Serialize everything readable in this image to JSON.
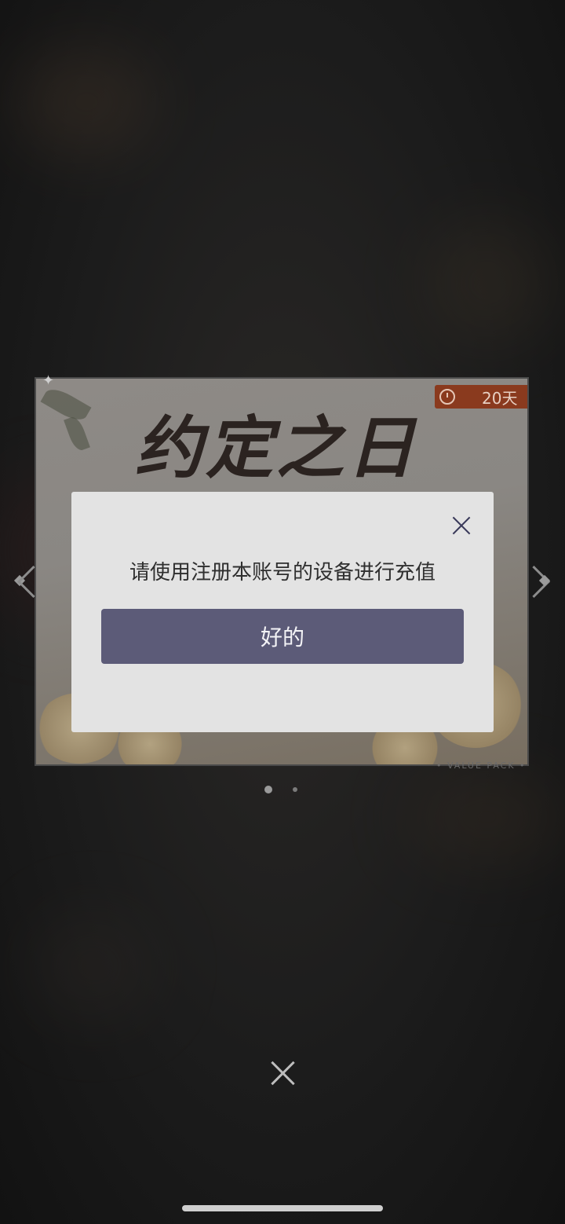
{
  "banner": {
    "title": "约定之日",
    "timer": {
      "icon": "clock-icon",
      "text": "20天"
    },
    "value_pack": "• VALUE PACK •"
  },
  "dialog": {
    "message": "请使用注册本账号的设备进行充值",
    "confirm_label": "好的",
    "close_icon": "close-icon"
  },
  "pager": {
    "count": 2,
    "active_index": 0
  },
  "colors": {
    "dialog_bg": "#e3e3e3",
    "confirm_button": "#5c5b78",
    "timer_badge": "#8a3a1e"
  }
}
